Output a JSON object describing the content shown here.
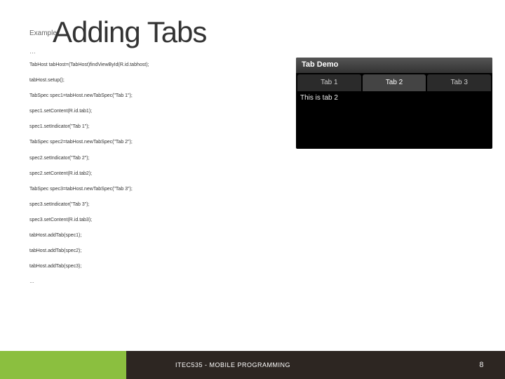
{
  "title": "Adding Tabs",
  "exampleLabel": "Example:",
  "topEllipsis": "…",
  "code": [
    "TabHost tabHost=(TabHost)findViewById(R.id.tabhost);",
    "tabHost.setup();",
    "TabSpec spec1=tabHost.newTabSpec(\"Tab 1\");",
    "spec1.setContent(R.id.tab1);",
    "spec1.setIndicator(\"Tab 1\");",
    "TabSpec spec2=tabHost.newTabSpec(\"Tab 2\");",
    "spec2.setIndicator(\"Tab 2\");",
    "spec2.setContent(R.id.tab2);",
    "TabSpec spec3=tabHost.newTabSpec(\"Tab 3\");",
    "spec3.setIndicator(\"Tab 3\");",
    "spec3.setContent(R.id.tab3);",
    "tabHost.addTab(spec1);",
    "tabHost.addTab(spec2);",
    "tabHost.addTab(spec3);",
    "…"
  ],
  "device": {
    "header": "Tab Demo",
    "tabs": [
      "Tab 1",
      "Tab 2",
      "Tab 3"
    ],
    "activeIndex": 1,
    "content": "This is tab 2"
  },
  "footer": {
    "course": "ITEC535 - MOBILE PROGRAMMING",
    "page": "8"
  }
}
